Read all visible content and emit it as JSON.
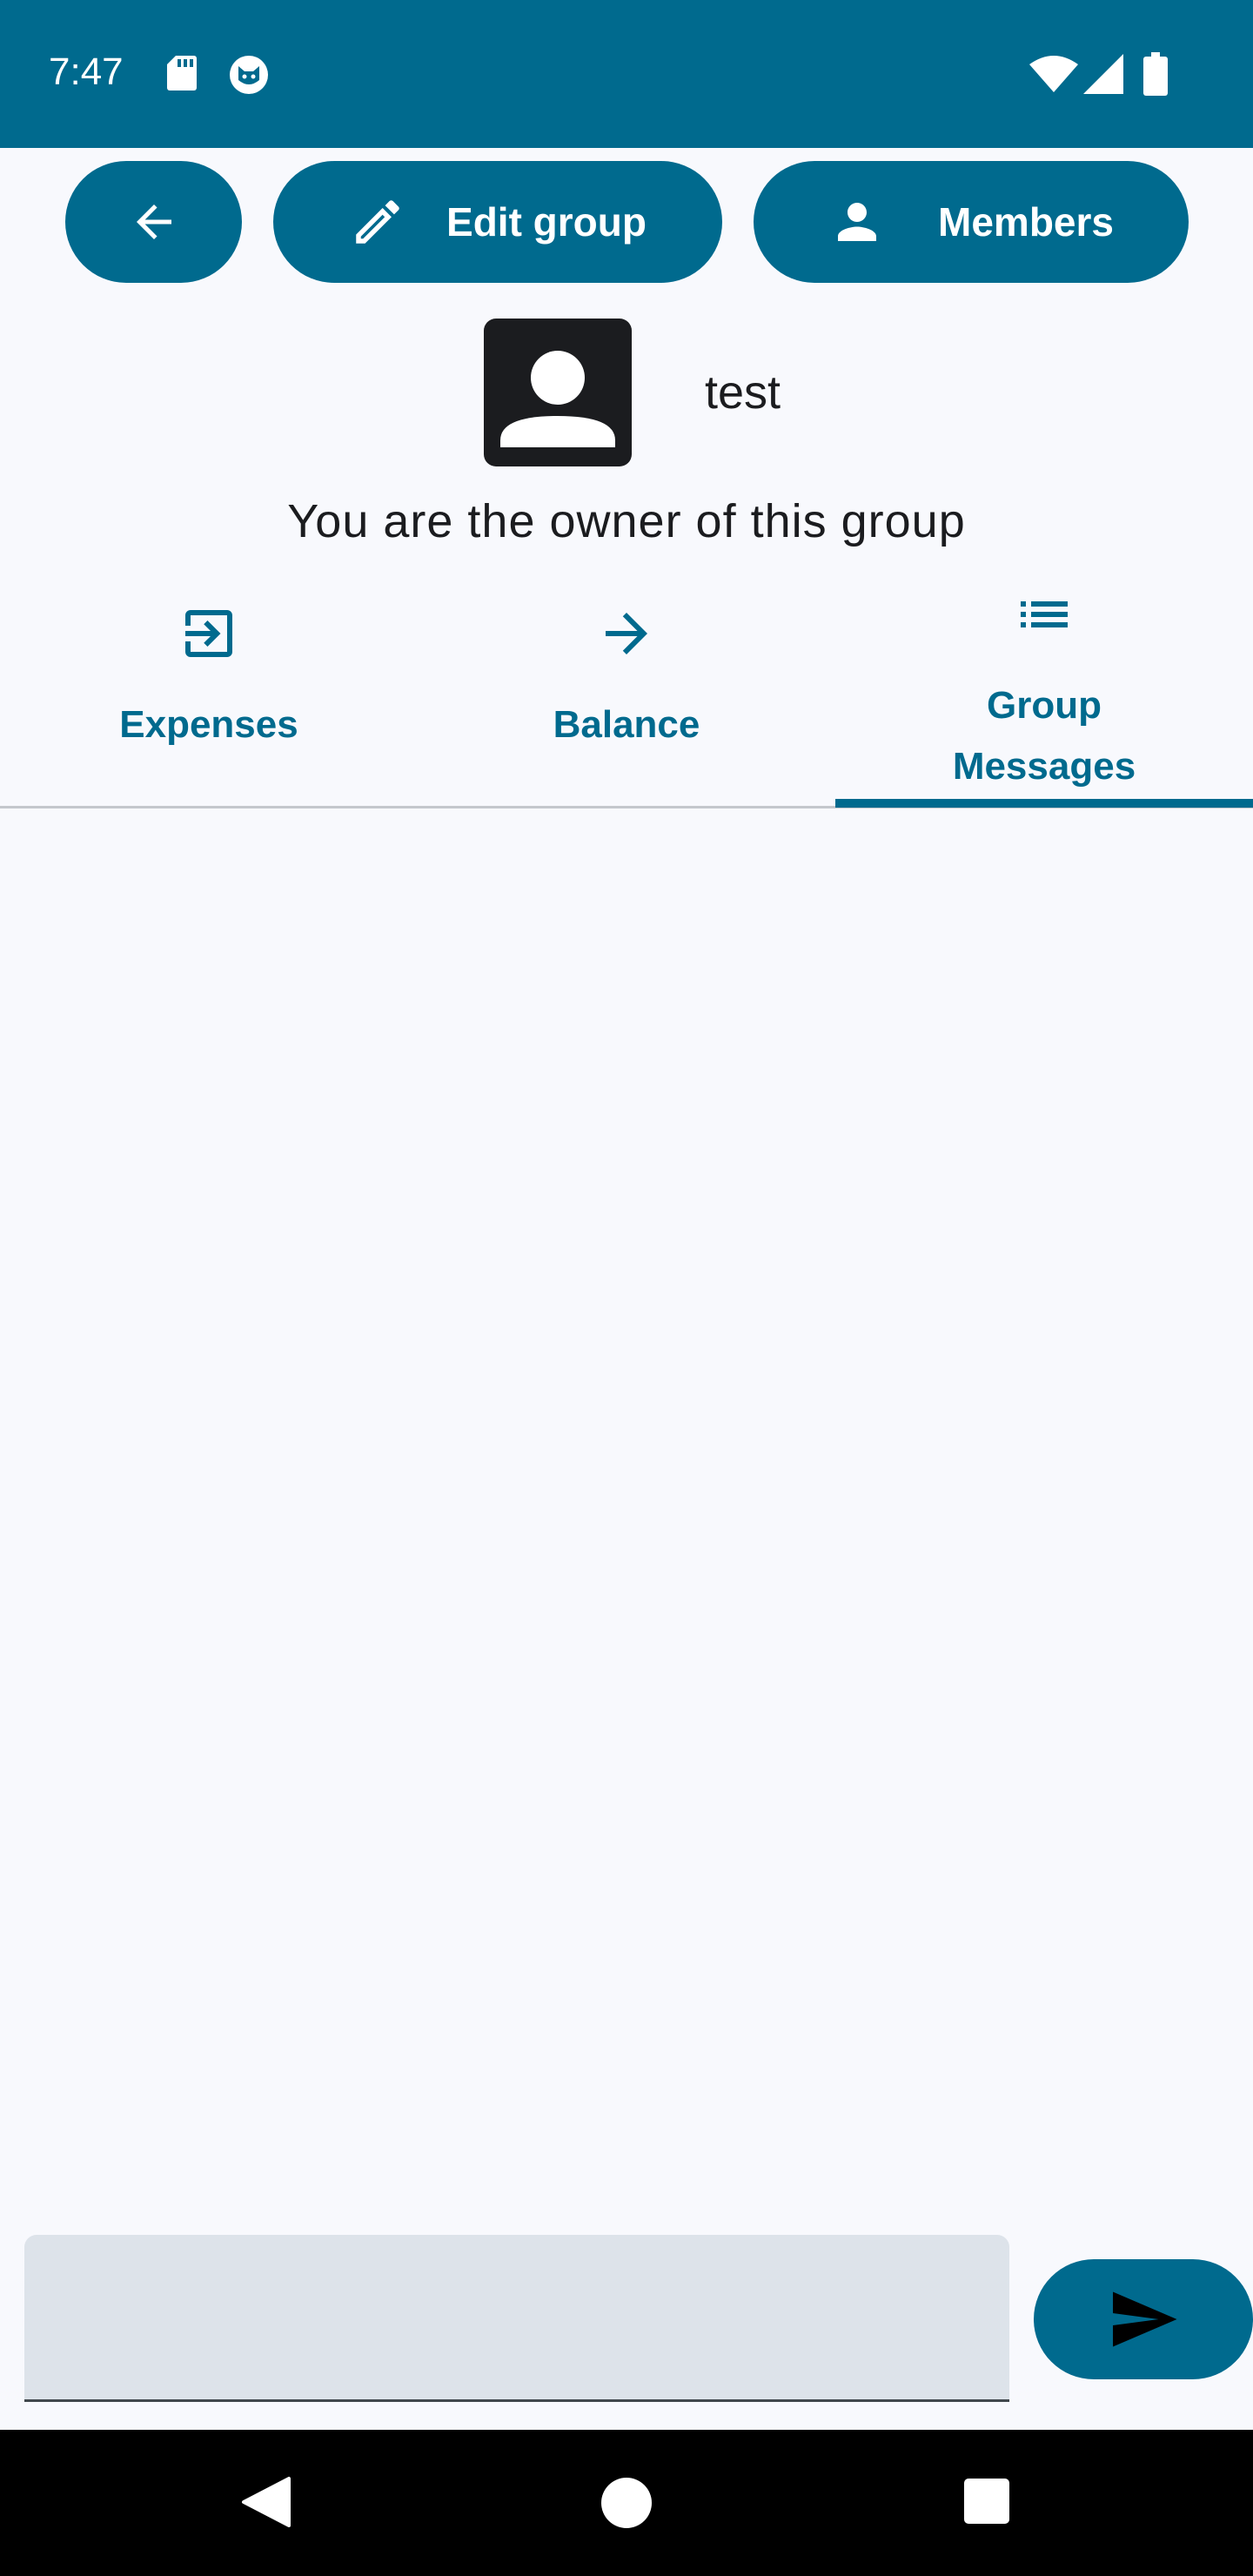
{
  "status_bar": {
    "time": "7:47",
    "icons": [
      "sd-card-icon",
      "cat-face-icon",
      "wifi-icon",
      "signal-icon",
      "battery-icon"
    ],
    "background_color": "#006A8E"
  },
  "toolbar": {
    "back_icon": "arrow-left-icon",
    "edit_group_label": "Edit group",
    "edit_icon": "pencil-icon",
    "members_label": "Members",
    "members_icon": "person-icon",
    "button_color": "#006A8E"
  },
  "group": {
    "name": "test",
    "avatar_icon": "account-box-icon",
    "owner_notice": "You are the owner of this group"
  },
  "tabs": [
    {
      "label": "Expenses",
      "icon": "login-box-icon",
      "selected": false
    },
    {
      "label": "Balance",
      "icon": "arrow-right-icon",
      "selected": false
    },
    {
      "label_line1": "Group",
      "label_line2": "Messages",
      "icon": "list-icon",
      "selected": true
    }
  ],
  "composer": {
    "input_value": "",
    "send_icon": "send-icon"
  },
  "nav_bar": {
    "buttons": [
      "back-triangle-icon",
      "home-circle-icon",
      "recents-square-icon"
    ]
  },
  "colors": {
    "accent": "#006A8E",
    "background": "#F8F9FD",
    "input_fill": "#DDE3EA"
  }
}
